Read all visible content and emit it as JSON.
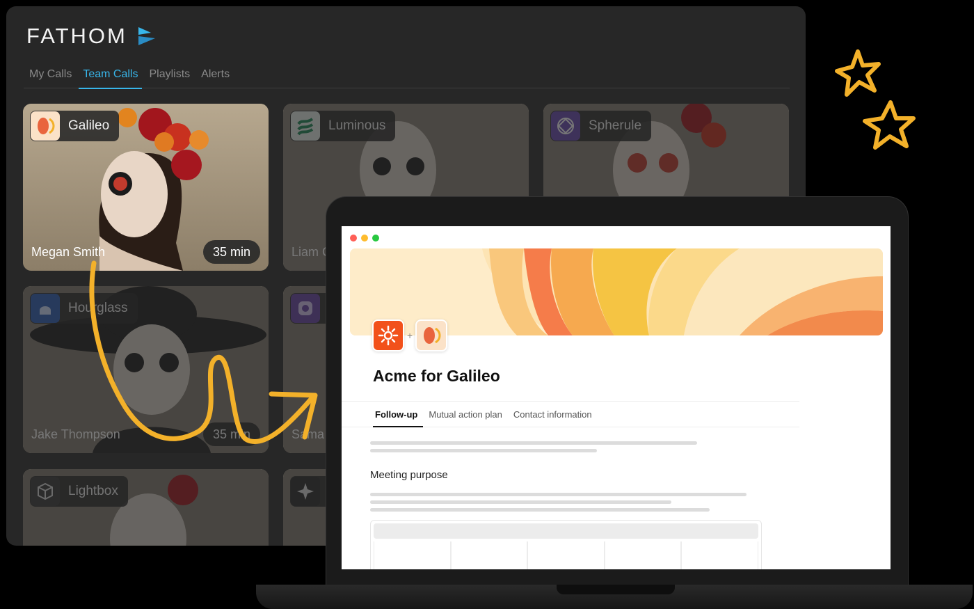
{
  "brand": {
    "name": "FATHOM",
    "accent": "#38b6ea"
  },
  "tabs": [
    {
      "label": "My Calls",
      "active": false
    },
    {
      "label": "Team Calls",
      "active": true
    },
    {
      "label": "Playlists",
      "active": false
    },
    {
      "label": "Alerts",
      "active": false
    }
  ],
  "cards": [
    {
      "company": "Galileo",
      "person": "Megan Smith",
      "duration": "35 min",
      "logo_icon": "galileo-icon"
    },
    {
      "company": "Luminous",
      "person": "Liam C",
      "duration": "",
      "logo_icon": "luminous-icon"
    },
    {
      "company": "Spherule",
      "person": "",
      "duration": "",
      "logo_icon": "spherule-icon"
    },
    {
      "company": "Hourglass",
      "person": "Jake Thompson",
      "duration": "35 min",
      "logo_icon": "hourglass-icon"
    },
    {
      "company": "",
      "person": "Sama",
      "duration": "",
      "logo_icon": "camera-icon"
    },
    {
      "company": "Lightbox",
      "person": "",
      "duration": "",
      "logo_icon": "cube-icon"
    },
    {
      "company": "",
      "person": "",
      "duration": "",
      "logo_icon": "sparkle-icon"
    }
  ],
  "doc": {
    "title": "Acme for Galileo",
    "tabs": [
      {
        "label": "Follow-up",
        "active": true
      },
      {
        "label": "Mutual action plan",
        "active": false
      },
      {
        "label": "Contact information",
        "active": false
      }
    ],
    "section_title": "Meeting purpose",
    "plus": "+"
  },
  "colors": {
    "star": "#f3b12a",
    "arrow": "#f3b12a",
    "acme": "#f2511b",
    "galileo": "#e9643d"
  }
}
